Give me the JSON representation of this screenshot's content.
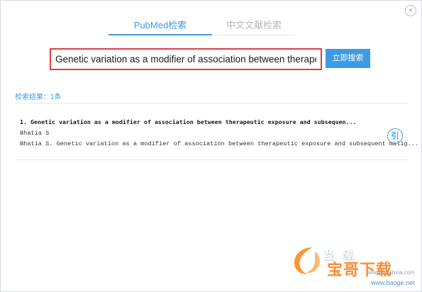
{
  "window": {
    "close_symbol": "×"
  },
  "tabs": [
    {
      "label": "PubMed检索",
      "active": true
    },
    {
      "label": "中文文献检索",
      "active": false
    }
  ],
  "search": {
    "value": "Genetic variation as a modifier of association between therapeutic",
    "button_label": "立即搜索"
  },
  "results": {
    "summary": "检索结果：1条",
    "items": [
      {
        "title": "1. Genetic variation as a modifier of association between therapeutic exposure and subsequen...",
        "author": "Bhatia S",
        "citation": "Bhatia S. Genetic variation as a modifier of association between therapeutic exposure and subsequent malig...",
        "cite_label": "引"
      }
    ]
  },
  "watermark": {
    "top_text": "当 载",
    "brand": "宝哥下载",
    "site_partial": "www.downxia.com",
    "site": "www.baoge.net"
  },
  "colors": {
    "accent": "#3d9ae4",
    "highlight_border": "#e13d3d",
    "watermark_orange": "#ff7f1f"
  },
  "icons": {
    "close": "close-icon",
    "cite": "cite-icon",
    "watermark_logo": "watermark-logo-icon"
  }
}
